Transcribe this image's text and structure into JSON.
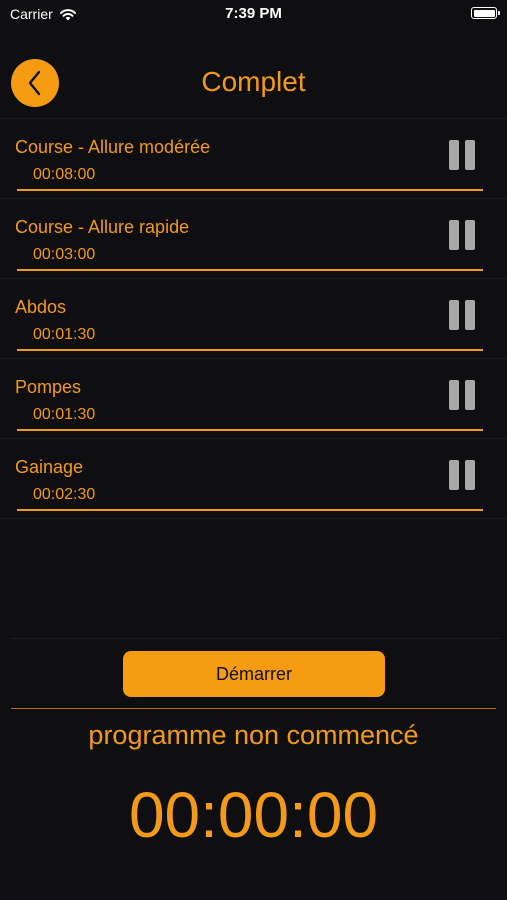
{
  "status_bar": {
    "carrier": "Carrier",
    "time": "7:39 PM"
  },
  "header": {
    "title": "Complet",
    "back_icon": "chevron-left-icon"
  },
  "exercises": [
    {
      "name": "Course - Allure modérée",
      "duration": "00:08:00"
    },
    {
      "name": "Course - Allure rapide",
      "duration": "00:03:00"
    },
    {
      "name": "Abdos",
      "duration": "00:01:30"
    },
    {
      "name": "Pompes",
      "duration": "00:01:30"
    },
    {
      "name": "Gainage",
      "duration": "00:02:30"
    }
  ],
  "controls": {
    "start_label": "Démarrer"
  },
  "program": {
    "status": "programme non commencé",
    "timer": "00:00:00"
  },
  "colors": {
    "accent": "#f39a1a",
    "background": "#0f0f11",
    "pause_icon": "#a8a8a8"
  }
}
